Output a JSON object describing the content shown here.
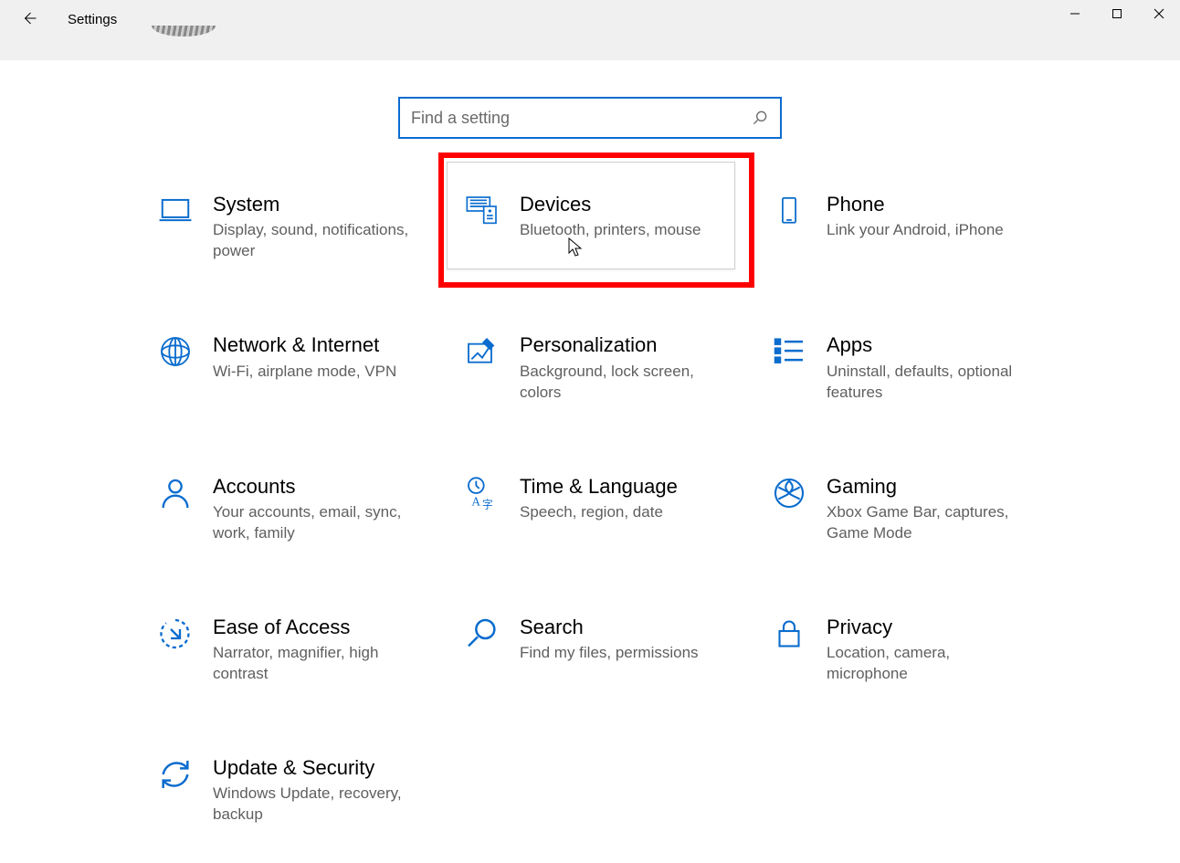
{
  "window": {
    "title": "Settings",
    "search_placeholder": "Find a setting"
  },
  "tiles": [
    {
      "id": "system",
      "title": "System",
      "sub": "Display, sound, notifications, power"
    },
    {
      "id": "devices",
      "title": "Devices",
      "sub": "Bluetooth, printers, mouse",
      "highlighted": true
    },
    {
      "id": "phone",
      "title": "Phone",
      "sub": "Link your Android, iPhone"
    },
    {
      "id": "network",
      "title": "Network & Internet",
      "sub": "Wi-Fi, airplane mode, VPN"
    },
    {
      "id": "personalization",
      "title": "Personalization",
      "sub": "Background, lock screen, colors"
    },
    {
      "id": "apps",
      "title": "Apps",
      "sub": "Uninstall, defaults, optional features"
    },
    {
      "id": "accounts",
      "title": "Accounts",
      "sub": "Your accounts, email, sync, work, family"
    },
    {
      "id": "time-language",
      "title": "Time & Language",
      "sub": "Speech, region, date"
    },
    {
      "id": "gaming",
      "title": "Gaming",
      "sub": "Xbox Game Bar, captures, Game Mode"
    },
    {
      "id": "ease-of-access",
      "title": "Ease of Access",
      "sub": "Narrator, magnifier, high contrast"
    },
    {
      "id": "search",
      "title": "Search",
      "sub": "Find my files, permissions"
    },
    {
      "id": "privacy",
      "title": "Privacy",
      "sub": "Location, camera, microphone"
    },
    {
      "id": "update-security",
      "title": "Update & Security",
      "sub": "Windows Update, recovery, backup"
    }
  ]
}
